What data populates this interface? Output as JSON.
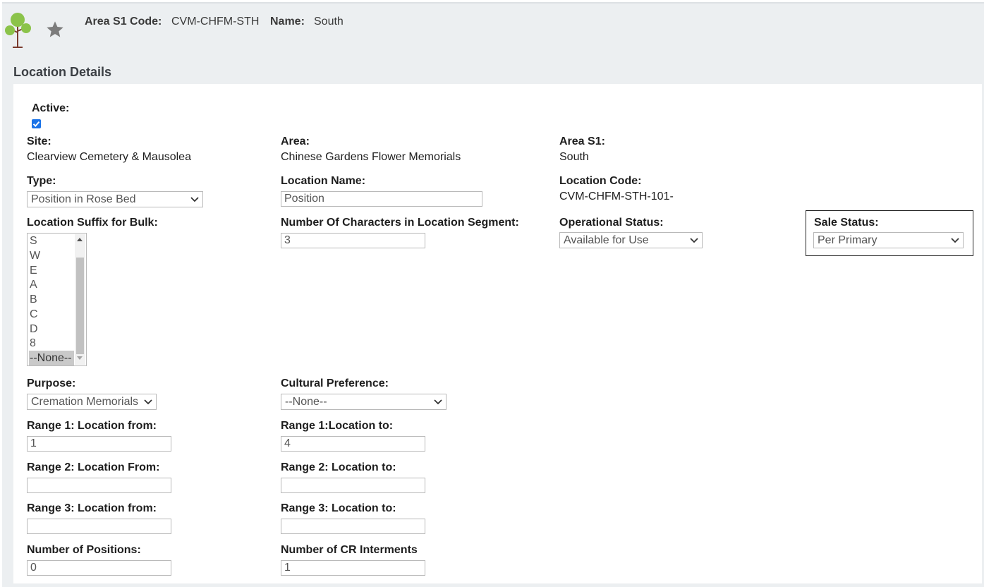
{
  "header": {
    "area_s1_code_label": "Area S1 Code:",
    "area_s1_code_value": "CVM-CHFM-STH",
    "name_label": "Name:",
    "name_value": "South",
    "icons": [
      "tree-icon",
      "star-icon"
    ]
  },
  "section_title": "Location Details",
  "fields": {
    "active": {
      "label": "Active:",
      "checked": true
    },
    "site": {
      "label": "Site:",
      "value": "Clearview Cemetery & Mausolea"
    },
    "area": {
      "label": "Area:",
      "value": "Chinese Gardens Flower Memorials"
    },
    "area_s1": {
      "label": "Area S1:",
      "value": "South"
    },
    "type": {
      "label": "Type:",
      "value": "Position in Rose Bed"
    },
    "location_name": {
      "label": "Location Name:",
      "value": "Position"
    },
    "location_code": {
      "label": "Location Code:",
      "value": "CVM-CHFM-STH-101-"
    },
    "location_suffix": {
      "label": "Location Suffix for Bulk:",
      "options": [
        "S",
        "W",
        "E",
        "A",
        "B",
        "C",
        "D",
        "8",
        "--None--"
      ],
      "selected": "--None--"
    },
    "num_chars_segment": {
      "label": "Number Of Characters in Location Segment:",
      "value": "3"
    },
    "operational_status": {
      "label": "Operational Status:",
      "value": "Available for Use"
    },
    "sale_status": {
      "label": "Sale Status:",
      "value": "Per Primary"
    },
    "purpose": {
      "label": "Purpose:",
      "value": "Cremation Memorials"
    },
    "cultural_preference": {
      "label": "Cultural Preference:",
      "value": "--None--"
    },
    "range1_from": {
      "label": "Range 1: Location from:",
      "value": "1"
    },
    "range1_to": {
      "label": "Range 1:Location to:",
      "value": "4"
    },
    "range2_from": {
      "label": "Range 2: Location From:",
      "value": ""
    },
    "range2_to": {
      "label": "Range 2: Location to:",
      "value": ""
    },
    "range3_from": {
      "label": "Range 3: Location from:",
      "value": ""
    },
    "range3_to": {
      "label": "Range 3: Location to:",
      "value": ""
    },
    "num_positions": {
      "label": "Number of Positions:",
      "value": "0"
    },
    "num_cr_interments": {
      "label": "Number of CR Interments",
      "value": "1"
    }
  },
  "colors": {
    "checkbox": "#1a73e8",
    "header_bg": "#eceff1",
    "tree_leaf": "#8bc34a"
  }
}
